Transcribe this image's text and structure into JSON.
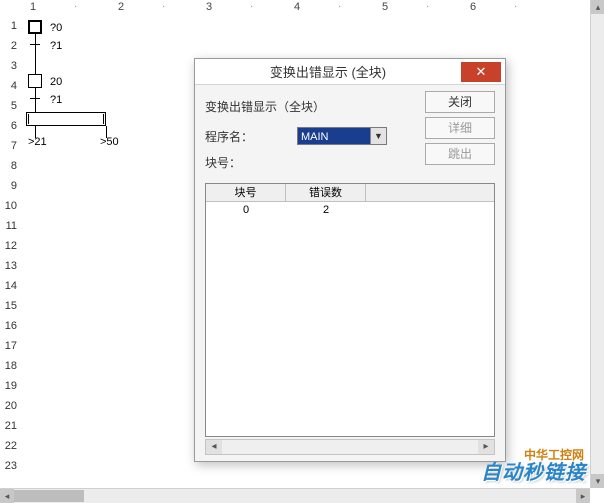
{
  "ruler": {
    "cols": [
      1,
      2,
      3,
      4,
      5,
      6
    ]
  },
  "rows": [
    1,
    2,
    3,
    4,
    5,
    6,
    7,
    8,
    9,
    10,
    11,
    12,
    13,
    14,
    15,
    16,
    17,
    18,
    19,
    20,
    21,
    22,
    23
  ],
  "diagram": {
    "lbl_q0": "?0",
    "lbl_q1": "?1",
    "lbl_20": "20",
    "lbl_a21": ">21",
    "lbl_a50": ">50"
  },
  "dialog": {
    "title": "变换出错显示 (全块)",
    "subtitle": "变换出错显示（全块）",
    "prog_label": "程序名：",
    "block_label": "块号：",
    "prog_value": "MAIN",
    "btn_close": "关闭",
    "btn_detail": "详细",
    "btn_jump": "跳出",
    "col_block": "块号",
    "col_errors": "错误数",
    "table": [
      {
        "block": "0",
        "errors": "2"
      }
    ]
  },
  "watermark": "自动秒链接",
  "watermark_small": "中华工控网"
}
